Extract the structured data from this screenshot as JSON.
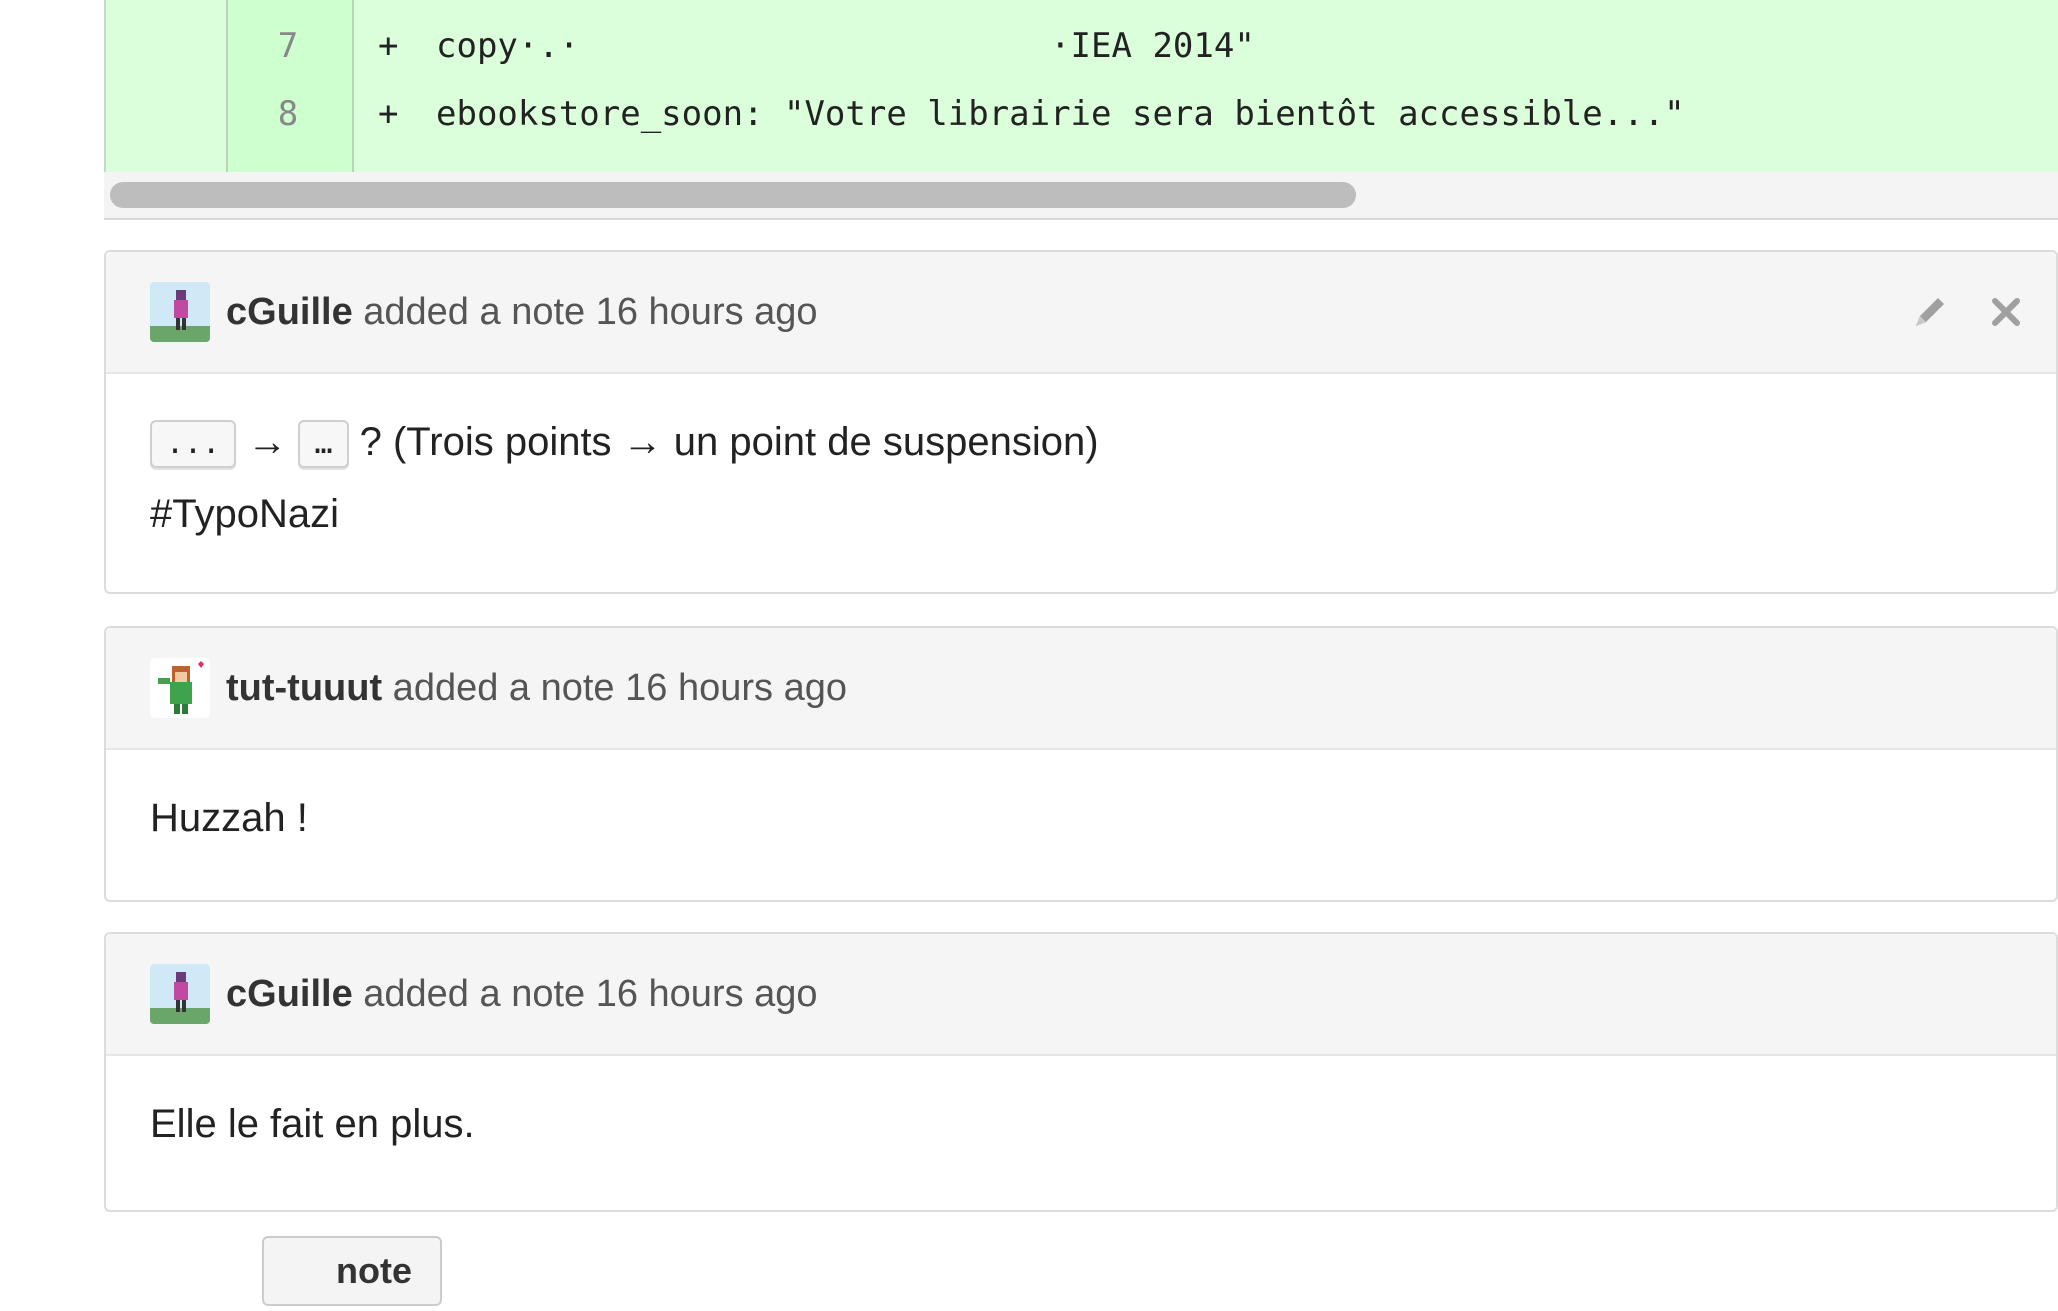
{
  "diff": {
    "lines": [
      {
        "number": "7",
        "sign": "+",
        "code": "copy·.·                       ·IEA 2014\""
      },
      {
        "number": "8",
        "sign": "+",
        "code": "ebookstore_soon: \"Votre librairie sera bientôt accessible...\""
      }
    ]
  },
  "notes": [
    {
      "author": "cGuille",
      "action": " added a note ",
      "time": "16 hours ago",
      "body": {
        "kbd_a": "...",
        "arrow": "→",
        "kbd_b": "…",
        "rest": "? (Trois points → un point de suspension)",
        "line2": "#TypoNazi"
      },
      "avatar_icon": "pixel-person-icon"
    },
    {
      "author": "tut-tuuut",
      "action": " added a note ",
      "time": "16 hours ago",
      "body_text": "Huzzah !",
      "avatar_icon": "pixel-girl-heart-icon"
    },
    {
      "author": "cGuille",
      "action": " added a note ",
      "time": "16 hours ago",
      "body_text": "Elle le fait en plus.",
      "avatar_icon": "pixel-person-icon"
    }
  ],
  "actions": {
    "add_note_label": "note",
    "edit_icon": "pencil-icon",
    "delete_icon": "close-icon"
  },
  "colors": {
    "diff_added_bg": "#dbffdb",
    "diff_gutter_bg": "#ceffce",
    "note_header_bg": "#f5f5f5"
  }
}
